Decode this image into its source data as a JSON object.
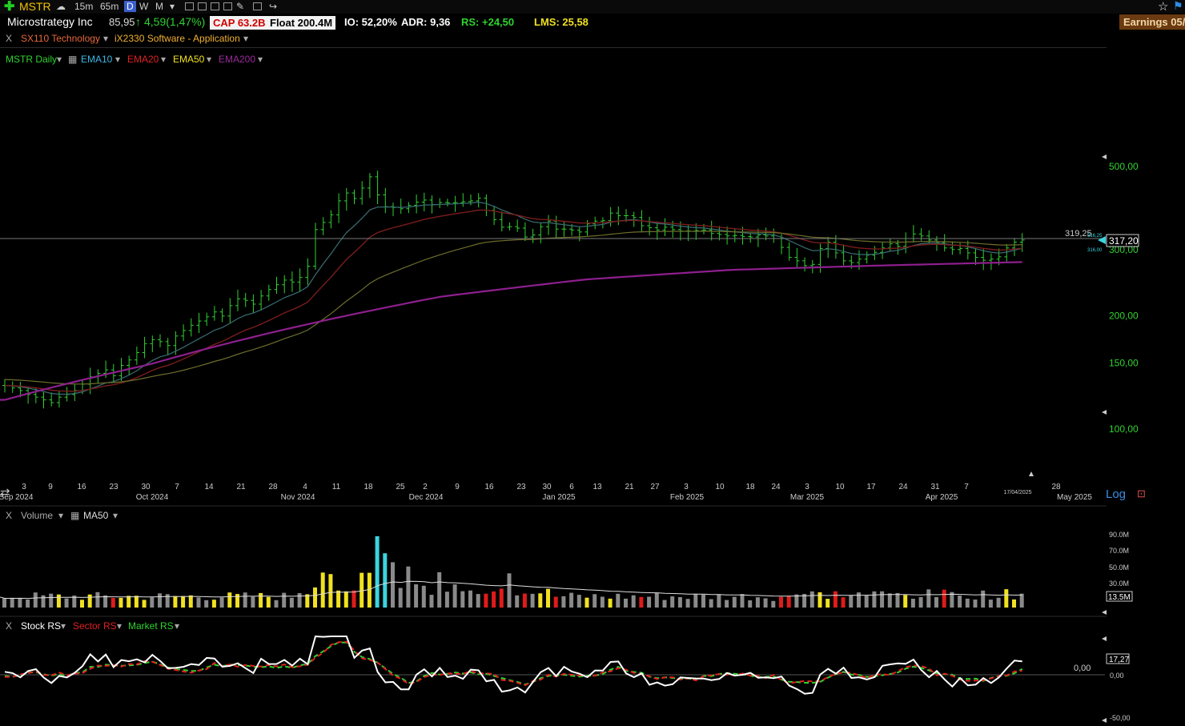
{
  "toolbar": {
    "symbol": "MSTR",
    "timeframes": [
      "15m",
      "65m",
      "D",
      "W",
      "M"
    ],
    "active_timeframe": "D"
  },
  "quote": {
    "company": "Microstrategy Inc",
    "price": "85,95",
    "change": "4,59(1,47%)",
    "cap": "CAP 63.2B",
    "float": "Float 200.4M",
    "io": "IO: 52,20%",
    "adr": "ADR: 9,36",
    "rs": "RS: +24,50",
    "lms": "LMS: 25,58",
    "earnings": "Earnings 05/"
  },
  "sector": {
    "close": "X",
    "sector": "SX110 Technology",
    "industry": "iX2330 Software - Application"
  },
  "price_legend": {
    "series": "MSTR Daily",
    "ema10": "EMA10",
    "ema20": "EMA20",
    "ema50": "EMA50",
    "ema200": "EMA200"
  },
  "price_axis": {
    "labels": [
      "500,00",
      "300,00",
      "200,00",
      "150,00",
      "100,00"
    ],
    "current_price": "317,20",
    "hline_value": "319,25",
    "mini_labels": [
      "316,25",
      "316,00"
    ],
    "log_label": "Log"
  },
  "x_axis": {
    "ticks": [
      "3",
      "9",
      "16",
      "23",
      "30",
      "7",
      "14",
      "21",
      "28",
      "4",
      "11",
      "18",
      "25",
      "2",
      "9",
      "16",
      "23",
      "30",
      "6",
      "13",
      "21",
      "27",
      "3",
      "10",
      "18",
      "24",
      "3",
      "10",
      "17",
      "24",
      "31",
      "7",
      "17/04/2025",
      "28"
    ],
    "months": [
      "Sep 2024",
      "Oct 2024",
      "Nov 2024",
      "Dec 2024",
      "Jan 2025",
      "Feb 2025",
      "Mar 2025",
      "Apr 2025",
      "May 2025"
    ]
  },
  "volume_legend": {
    "close": "X",
    "label": "Volume",
    "ma": "MA50"
  },
  "volume_axis": {
    "labels": [
      "90.0M",
      "70.0M",
      "50.0M",
      "30.0M"
    ],
    "current": "13.5M"
  },
  "rs_legend": {
    "close": "X",
    "stock": "Stock RS",
    "sector": "Sector RS",
    "market": "Market RS"
  },
  "rs_axis": {
    "zero": "0,00",
    "labels": [
      "0,00",
      "-50,00"
    ],
    "current": "17,27"
  },
  "colors": {
    "up": "#2fd32f",
    "ema10": "#3a6e74",
    "ema20": "#7a1c1c",
    "ema50": "#6e6e2c",
    "ema200": "#8e1f8e",
    "vol_gray": "#8a8a8a",
    "vol_red": "#e01b1b",
    "vol_yellow": "#f0e020",
    "vol_cyan": "#3ad5e0"
  },
  "chart_data": {
    "type": "line",
    "title": "MSTR Daily",
    "scale": "log",
    "ylim": [
      80,
      600
    ],
    "events": {
      "x_span": "2024-09-02 to 2025-05-02"
    },
    "series": [
      {
        "name": "MSTR Daily",
        "kind": "ohlc-bars",
        "close": [
          130,
          128,
          126,
          123,
          121,
          119,
          117,
          121,
          123,
          126,
          131,
          137,
          140,
          143,
          138,
          147,
          152,
          159,
          168,
          172,
          170,
          166,
          176,
          182,
          188,
          193,
          198,
          204,
          199,
          212,
          221,
          219,
          214,
          225,
          234,
          241,
          248,
          245,
          252,
          270,
          338,
          353,
          370,
          403,
          423,
          409,
          436,
          467,
          418,
          389,
          387,
          384,
          392,
          400,
          405,
          394,
          399,
          398,
          399,
          401,
          403,
          410,
          380,
          359,
          343,
          344,
          341,
          323,
          327,
          344,
          356,
          339,
          339,
          337,
          333,
          350,
          356,
          357,
          374,
          368,
          368,
          364,
          346,
          342,
          337,
          343,
          338,
          335,
          335,
          336,
          337,
          330,
          328,
          325,
          326,
          324,
          323,
          327,
          325,
          320,
          303,
          285,
          279,
          271,
          273,
          301,
          313,
          293,
          279,
          276,
          282,
          289,
          294,
          302,
          310,
          305,
          320,
          329,
          325,
          317,
          312,
          302,
          299,
          301,
          293,
          285,
          280,
          282,
          286,
          302,
          313,
          317
        ]
      },
      {
        "name": "EMA200",
        "kind": "line",
        "values": [
          119,
          148,
          186,
          224,
          249,
          264,
          271,
          277
        ]
      }
    ]
  }
}
